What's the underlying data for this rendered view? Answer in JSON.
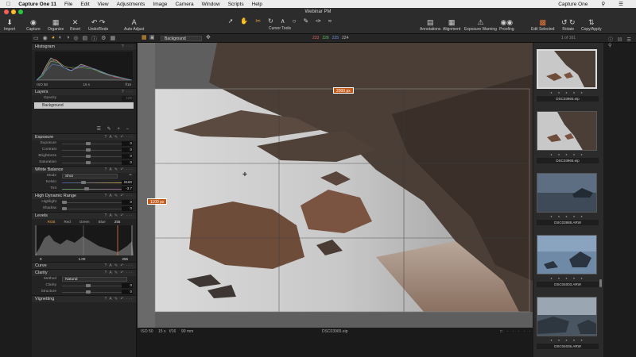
{
  "menubar": {
    "app_name": "Capture One 11",
    "items": [
      "File",
      "Edit",
      "View",
      "Adjustments",
      "Image",
      "Camera",
      "Window",
      "Scripts",
      "Help"
    ],
    "right_label": "Capture One"
  },
  "window": {
    "title": "Webinar PM"
  },
  "toolbar": {
    "left_buttons": [
      "Import",
      "Capture",
      "Organize",
      "Reset",
      "Undo/Redo",
      "Auto Adjust"
    ],
    "cursor_tools_label": "Cursor Tools",
    "right_buttons": [
      "Annotations",
      "Alignment",
      "Exposure Warning",
      "Proofing",
      "Edit Selected",
      "Rotate",
      "Copy/Apply"
    ]
  },
  "subbar": {
    "background_option": "Background",
    "rgb": {
      "r": "233",
      "g": "226",
      "b": "225",
      "l": "224"
    },
    "browser_count": "1 of 161"
  },
  "panels": {
    "histogram": {
      "title": "Histogram",
      "iso": "ISO 50",
      "shutter": "15 s",
      "aperture": "f/16"
    },
    "layers": {
      "title": "Layers",
      "opacity_label": "Opacity",
      "opacity_value": "100",
      "layer_name": "Background"
    },
    "exposure": {
      "title": "Exposure",
      "rows": [
        {
          "label": "Exposure",
          "value": "0"
        },
        {
          "label": "Contrast",
          "value": "0"
        },
        {
          "label": "Brightness",
          "value": "0"
        },
        {
          "label": "Saturation",
          "value": "0"
        }
      ]
    },
    "white_balance": {
      "title": "White Balance",
      "mode_label": "Mode",
      "mode_value": "Shot",
      "rows": [
        {
          "label": "Kelvin",
          "value": "6160"
        },
        {
          "label": "Tint",
          "value": "-3.7"
        }
      ]
    },
    "hdr": {
      "title": "High Dynamic Range",
      "rows": [
        {
          "label": "Highlight",
          "value": "0"
        },
        {
          "label": "Shadow",
          "value": "0"
        }
      ]
    },
    "levels": {
      "title": "Levels",
      "tabs": [
        "RGB",
        "Red",
        "Green",
        "Blue"
      ],
      "top_value": "255",
      "bottom_values": [
        "0",
        "1.00",
        "255"
      ]
    },
    "curve": {
      "title": "Curve"
    },
    "clarity": {
      "title": "Clarity",
      "method_label": "Method",
      "method_value": "Natural",
      "rows": [
        {
          "label": "Clarity",
          "value": "0"
        },
        {
          "label": "Structure",
          "value": "0"
        }
      ]
    },
    "vignetting": {
      "title": "Vignetting"
    }
  },
  "viewer": {
    "width_badge": "2000 px",
    "height_badge": "1100 px",
    "status": {
      "iso": "ISO 50",
      "shutter": "15 s",
      "aperture": "f/16",
      "focal": "90 mm",
      "filename": "DSC03965.eip"
    }
  },
  "browser": {
    "thumbnails": [
      {
        "file": "DSC03965.eip",
        "selected": true
      },
      {
        "file": "DSC03965.eip",
        "selected": false
      },
      {
        "file": "DSC03988.ARW",
        "selected": false
      },
      {
        "file": "DSC04003.ARW",
        "selected": false
      },
      {
        "file": "DSC04036.ARW",
        "selected": false
      }
    ]
  }
}
